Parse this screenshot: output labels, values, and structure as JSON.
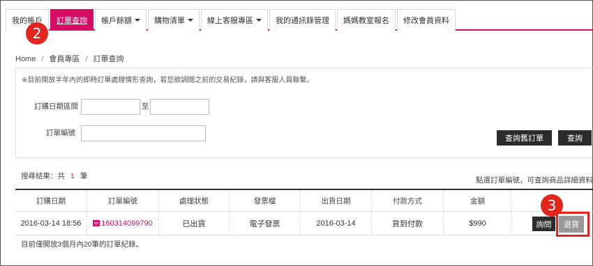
{
  "tabs": [
    {
      "label": "我的帳戶",
      "dropdown": false
    },
    {
      "label": "訂單查詢",
      "dropdown": false,
      "active": true
    },
    {
      "label": "帳戶餘額",
      "dropdown": true
    },
    {
      "label": "購物清單",
      "dropdown": true
    },
    {
      "label": "線上客服專區",
      "dropdown": true
    },
    {
      "label": "我的通訊錄管理",
      "dropdown": false
    },
    {
      "label": "媽媽教室報名",
      "dropdown": false
    },
    {
      "label": "修改會員資料",
      "dropdown": false
    }
  ],
  "steps": {
    "two": "2",
    "three": "3"
  },
  "breadcrumb": {
    "home": "Home",
    "section": "會員專區",
    "current": "訂單查詢",
    "sep": "/"
  },
  "search": {
    "notice": "※目前開放半年內的即時訂單處理情形查詢，若您欲調閱之前的交易紀錄，請與客服人員聯繫。",
    "date_label": "訂購日期區間",
    "date_to": "至",
    "date_from_value": "",
    "date_to_value": "",
    "order_no_label": "訂單編號",
    "order_no_value": "",
    "btn_old": "查詢舊訂單",
    "btn_query": "查詢"
  },
  "result": {
    "prefix": "搜尋結果：共",
    "count": "1",
    "suffix": "筆",
    "hint": "點選訂單編號，可查詢商品詳細資料"
  },
  "table": {
    "headers": [
      "訂購日期",
      "訂單編號",
      "處理狀態",
      "發票檔",
      "出貨日期",
      "付款方式",
      "金額",
      ""
    ],
    "rows": [
      {
        "date": "2016-03-14 18:56",
        "order_no": "160314099790",
        "status": "已出貨",
        "invoice": "電子發票",
        "ship_date": "2016-03-14",
        "payment": "貨到付款",
        "amount": "$990"
      }
    ],
    "btn_ask": "詢問",
    "btn_return": "退貨"
  },
  "footer": "目前僅開放3個月內20筆的訂單紀錄。",
  "colors": {
    "accent": "#d80c63",
    "marker": "#e4251d",
    "dark_button": "#2b2b2b"
  }
}
